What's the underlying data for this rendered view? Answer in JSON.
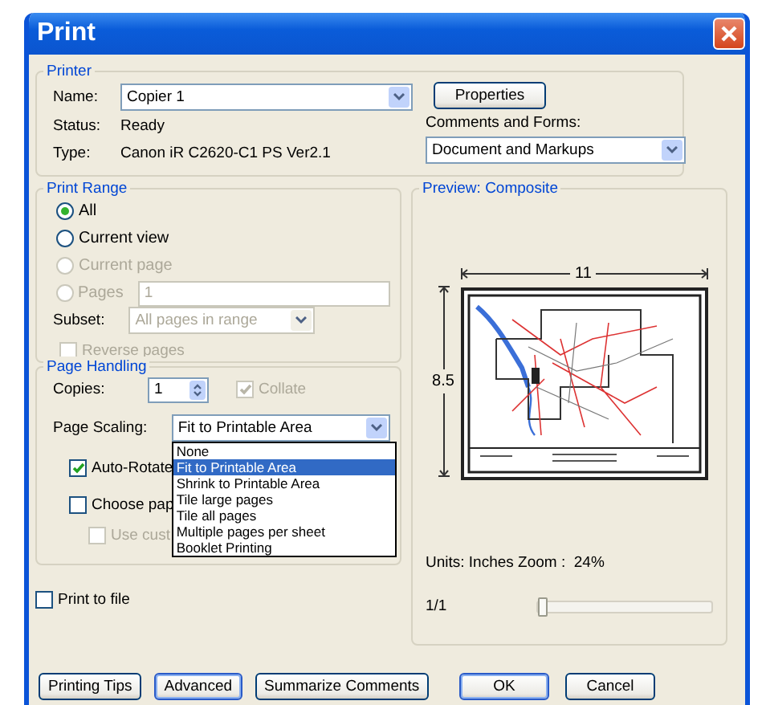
{
  "window": {
    "title": "Print"
  },
  "printer": {
    "group_label": "Printer",
    "name_label": "Name:",
    "name_value": "Copier 1",
    "status_label": "Status:",
    "status_value": "Ready",
    "type_label": "Type:",
    "type_value": "Canon iR C2620-C1 PS Ver2.1",
    "properties_button": "Properties",
    "comments_label": "Comments and Forms:",
    "comments_value": "Document and Markups"
  },
  "print_range": {
    "group_label": "Print Range",
    "options": [
      {
        "label": "All",
        "selected": true,
        "disabled": false
      },
      {
        "label": "Current view",
        "selected": false,
        "disabled": false
      },
      {
        "label": "Current page",
        "selected": false,
        "disabled": true
      },
      {
        "label": "Pages",
        "selected": false,
        "disabled": true
      }
    ],
    "pages_value": "1",
    "subset_label": "Subset:",
    "subset_value": "All pages in range",
    "subset_disabled": true,
    "reverse_pages": {
      "label": "Reverse pages",
      "checked": false,
      "disabled": true
    }
  },
  "page_handling": {
    "group_label": "Page Handling",
    "copies_label": "Copies:",
    "copies_value": "1",
    "collate": {
      "label": "Collate",
      "checked": true,
      "disabled": true
    },
    "scaling_label": "Page Scaling:",
    "scaling_value": "Fit to Printable Area",
    "scaling_expanded": true,
    "scaling_options": [
      {
        "label": "None",
        "selected": false
      },
      {
        "label": "Fit to Printable Area",
        "selected": true
      },
      {
        "label": "Shrink to Printable Area",
        "selected": false
      },
      {
        "label": "Tile large pages",
        "selected": false
      },
      {
        "label": "Tile all pages",
        "selected": false
      },
      {
        "label": "Multiple pages per sheet",
        "selected": false
      },
      {
        "label": "Booklet Printing",
        "selected": false
      }
    ],
    "checkboxes": [
      {
        "label": "Auto-Rotate",
        "checked": true,
        "disabled": false,
        "indented": false
      },
      {
        "label": "Choose pap",
        "checked": false,
        "disabled": false,
        "indented": false
      },
      {
        "label": "Use cust",
        "checked": false,
        "disabled": true,
        "indented": true
      }
    ]
  },
  "print_to_file": {
    "label": "Print to file",
    "checked": false
  },
  "preview": {
    "group_label": "Preview: Composite",
    "width_label": "11",
    "height_label": "8.5",
    "units": "Units: Inches Zoom :  24%",
    "page_counter": "1/1",
    "page_slider": {
      "level": 0
    }
  },
  "buttons_left": [
    {
      "label": "Printing Tips",
      "default": false
    },
    {
      "label": "Advanced",
      "default": true
    },
    {
      "label": "Summarize Comments",
      "default": false
    }
  ],
  "buttons_right": [
    {
      "label": "OK",
      "default": true
    },
    {
      "label": "Cancel",
      "default": false
    }
  ]
}
